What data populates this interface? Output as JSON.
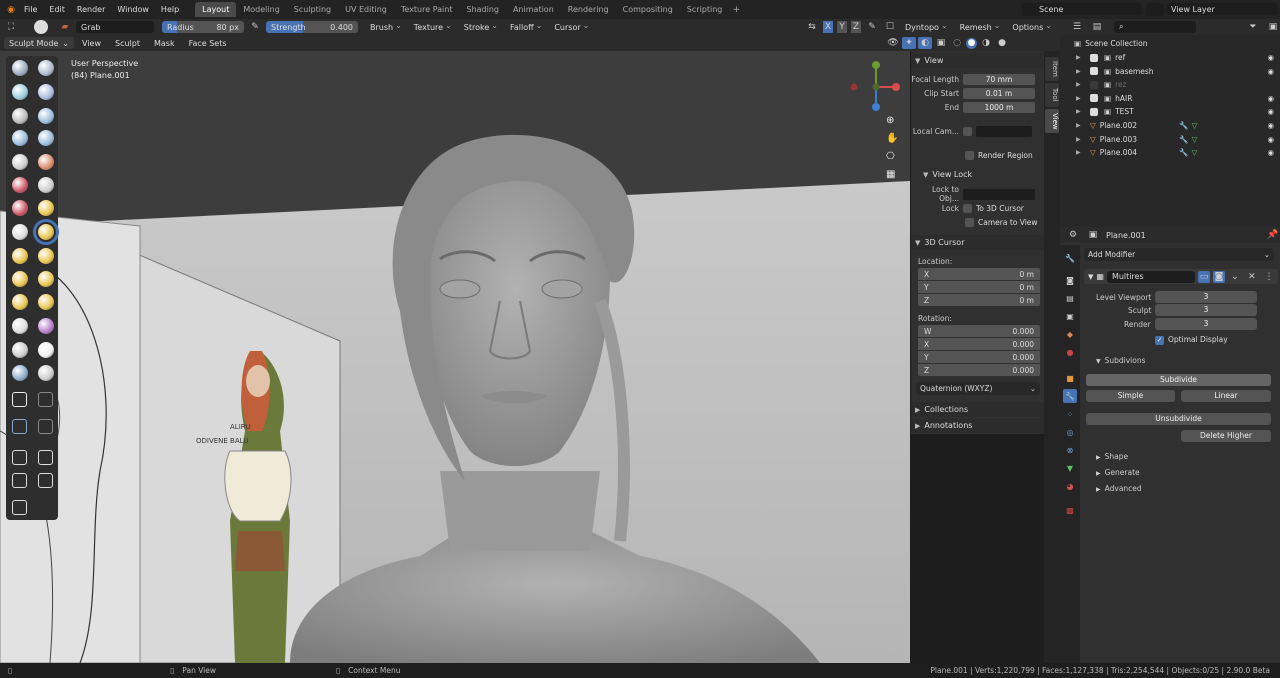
{
  "topbar": {
    "menus": [
      "File",
      "Edit",
      "Render",
      "Window",
      "Help"
    ],
    "workspaces": [
      "Layout",
      "Modeling",
      "Sculpting",
      "UV Editing",
      "Texture Paint",
      "Shading",
      "Animation",
      "Rendering",
      "Compositing",
      "Scripting"
    ],
    "active_workspace": "Layout",
    "scene": "Scene",
    "view_layer": "View Layer"
  },
  "tool_header": {
    "brush_name": "Grab",
    "radius_label": "Radius",
    "radius_value": "80 px",
    "strength_label": "Strength",
    "strength_value": "0.400",
    "menus": [
      "Brush",
      "Texture",
      "Stroke",
      "Falloff",
      "Cursor"
    ],
    "axis": [
      "X",
      "Y",
      "Z"
    ],
    "dyntopo": "Dyntopo",
    "remesh": "Remesh",
    "options": "Options"
  },
  "view_header": {
    "mode": "Sculpt Mode",
    "menus": [
      "View",
      "Sculpt",
      "Mask",
      "Face Sets"
    ]
  },
  "viewport": {
    "perspective": "User Perspective",
    "object": "(84) Plane.001",
    "ref_text1": "ALIRU",
    "ref_text2": "ODIVENE BALU"
  },
  "npanel": {
    "view": {
      "title": "View",
      "focal_label": "Focal Length",
      "focal_value": "70 mm",
      "clip_start_label": "Clip Start",
      "clip_start_value": "0.01 m",
      "end_label": "End",
      "end_value": "1000 m",
      "local_cam": "Local Cam...",
      "render_region": "Render Region"
    },
    "view_lock": {
      "title": "View Lock",
      "lock_obj": "Lock to Obj...",
      "lock": "Lock",
      "to_cursor": "To 3D Cursor",
      "camera_to_view": "Camera to View"
    },
    "cursor": {
      "title": "3D Cursor",
      "location": "Location:",
      "x": "0 m",
      "y": "0 m",
      "z": "0 m",
      "rotation": "Rotation:",
      "rw": "0.000",
      "rx": "0.000",
      "ry": "0.000",
      "rz": "0.000",
      "mode": "Quaternion (WXYZ)"
    },
    "collections": "Collections",
    "annotations": "Annotations",
    "tabs": [
      "Item",
      "Tool",
      "View"
    ]
  },
  "outliner": {
    "root": "Scene Collection",
    "items": [
      {
        "name": "ref"
      },
      {
        "name": "basemesh"
      },
      {
        "name": "rez"
      },
      {
        "name": "hAIR"
      },
      {
        "name": "TEST"
      },
      {
        "name": "Plane.002"
      },
      {
        "name": "Plane.003"
      },
      {
        "name": "Plane.004"
      }
    ]
  },
  "properties": {
    "object": "Plane.001",
    "add_modifier": "Add Modifier",
    "modifier_name": "Multires",
    "level_viewport_label": "Level Viewport",
    "level_viewport": "3",
    "sculpt_label": "Sculpt",
    "sculpt": "3",
    "render_label": "Render",
    "render": "3",
    "optimal_display": "Optimal Display",
    "subdivions": "Subdivions",
    "subdivide": "Subdivide",
    "simple": "Simple",
    "linear": "Linear",
    "unsubdivide": "Unsubdivide",
    "delete_higher": "Delete Higher",
    "shape": "Shape",
    "generate": "Generate",
    "advanced": "Advanced"
  },
  "status": {
    "pan": "Pan View",
    "context": "Context Menu",
    "stats": "Plane.001 | Verts:1,220,799 | Faces:1,127,338 | Tris:2,254,544 | Objects:0/25 | 2.90.0 Beta"
  }
}
